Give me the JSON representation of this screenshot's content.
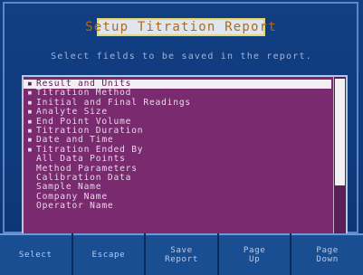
{
  "title": "Setup Titration Report",
  "instruction": "Select fields to be saved in the report.",
  "list": {
    "items": [
      {
        "label": "Result and Units",
        "checked": true,
        "selected": true
      },
      {
        "label": "Titration Method",
        "checked": true,
        "selected": false
      },
      {
        "label": "Initial and Final Readings",
        "checked": true,
        "selected": false
      },
      {
        "label": "Analyte Size",
        "checked": true,
        "selected": false
      },
      {
        "label": "End Point Volume",
        "checked": true,
        "selected": false
      },
      {
        "label": "Titration Duration",
        "checked": true,
        "selected": false
      },
      {
        "label": "Date and Time",
        "checked": true,
        "selected": false
      },
      {
        "label": "Titration Ended By",
        "checked": true,
        "selected": false
      },
      {
        "label": "All Data Points",
        "checked": false,
        "selected": false
      },
      {
        "label": "Method Parameters",
        "checked": false,
        "selected": false
      },
      {
        "label": "Calibration Data",
        "checked": false,
        "selected": false
      },
      {
        "label": "Sample Name",
        "checked": false,
        "selected": false
      },
      {
        "label": "Company Name",
        "checked": false,
        "selected": false
      },
      {
        "label": "Operator Name",
        "checked": false,
        "selected": false
      },
      {
        "label": "",
        "checked": false,
        "selected": false
      },
      {
        "label": "",
        "checked": false,
        "selected": false
      },
      {
        "label": "",
        "checked": false,
        "selected": false
      }
    ],
    "check_mark": "▪"
  },
  "buttons": [
    {
      "label": "Select"
    },
    {
      "label": "Escape"
    },
    {
      "label": "Save\nReport"
    },
    {
      "label": "Page\nUp"
    },
    {
      "label": "Page\nDown"
    }
  ],
  "colors": {
    "screen_bg": "#123f82",
    "list_bg": "#7a2a6e",
    "title_text": "#b06a18",
    "title_border": "#e6d86a",
    "button_bg": "#1a4e93"
  },
  "icons": {
    "check_mark": "checkbox-mark-icon"
  }
}
